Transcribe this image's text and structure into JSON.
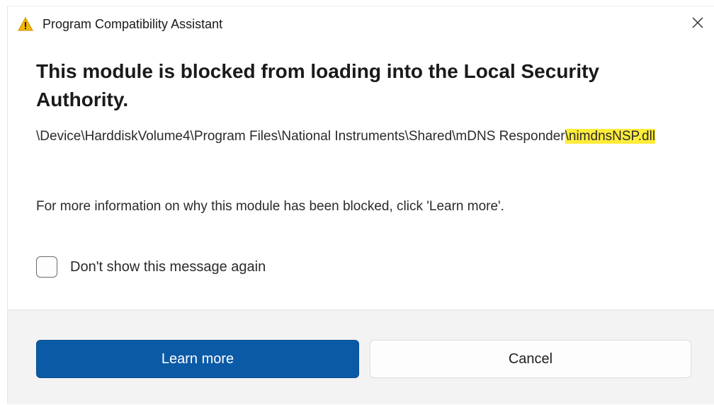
{
  "window": {
    "title": "Program Compatibility Assistant",
    "title_icon": "warning-triangle-icon",
    "close_icon": "close-icon"
  },
  "message": {
    "heading": "This module is blocked from loading into the Local Security Authority.",
    "path_prefix": "\\Device\\HarddiskVolume4\\Program Files\\National Instruments\\Shared\\mDNS Responder",
    "path_highlight": "\\nimdnsNSP.dll",
    "highlight_color": "#ffec3b",
    "info": "For more information on why this module has been blocked, click 'Learn more'."
  },
  "checkbox": {
    "label": "Don't show this message again",
    "checked": false
  },
  "buttons": {
    "learn_more": "Learn more",
    "cancel": "Cancel"
  },
  "colors": {
    "primary_button": "#0b5aa6",
    "warning_icon": "#f2b705",
    "footer_background": "#f3f3f3"
  }
}
